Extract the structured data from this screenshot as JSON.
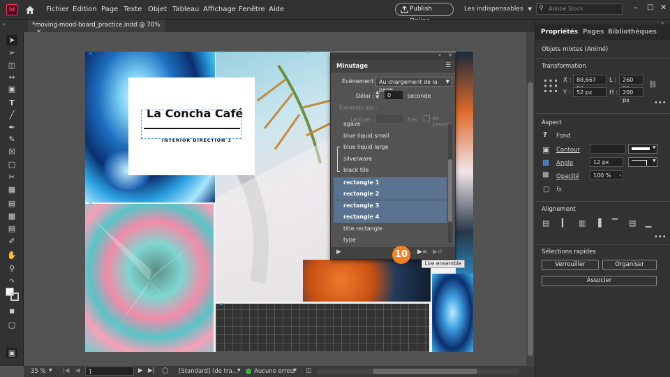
{
  "app": {
    "logo": "Id",
    "menus": [
      "Fichier",
      "Edition",
      "Page",
      "Texte",
      "Objet",
      "Tableau",
      "Affichage",
      "Fenêtre",
      "Aide"
    ],
    "publish_label": "Publish Online",
    "workspace": "Les indispensables",
    "stock_placeholder": "Adobe Stock"
  },
  "document_tab": {
    "title": "*moving-mood-board_practice.indd @ 70%",
    "close": "×"
  },
  "artboard": {
    "cafe_title": "La Concha Café",
    "cafe_subtitle": "INTERIOR DIRECTION 1"
  },
  "timing_panel": {
    "title": "Minutage",
    "event_label": "Événement :",
    "event_value": "Au chargement de la page",
    "delay_label": "Délai :",
    "delay_value": "0",
    "delay_unit": "seconde",
    "linked_label": "Éléments liés :",
    "play_label": "Lecture :",
    "times_label": "fois",
    "loop_label": "En boucle",
    "items": [
      {
        "label": "agave",
        "selected": false,
        "linked": false
      },
      {
        "label": "blue liquid small",
        "selected": false,
        "linked": false
      },
      {
        "label": "blue liquid large",
        "selected": false,
        "linked": true
      },
      {
        "label": "silverware",
        "selected": false,
        "linked": true
      },
      {
        "label": "black tile",
        "selected": false,
        "linked": true
      },
      {
        "label": "rectangle 1",
        "selected": true,
        "linked": false
      },
      {
        "label": "rectangle 2",
        "selected": true,
        "linked": false
      },
      {
        "label": "rectangle 3",
        "selected": true,
        "linked": false
      },
      {
        "label": "rectangle 4",
        "selected": true,
        "linked": false
      },
      {
        "label": "title rectangle",
        "selected": false,
        "linked": false
      },
      {
        "label": "type",
        "selected": false,
        "linked": false
      }
    ],
    "tooltip": "Lire ensemble",
    "step_number": "10"
  },
  "properties": {
    "tabs": [
      "Propriétés",
      "Pages",
      "Bibliothèques"
    ],
    "object_type": "Objets mixtes (Animé)",
    "transform_title": "Transformation",
    "x_label": "X :",
    "x_value": "88,667 px",
    "y_label": "Y :",
    "y_value": "52 px",
    "w_label": "L :",
    "w_value": "260 px",
    "h_label": "H :",
    "h_value": "200 px",
    "aspect_title": "Aspect",
    "fill_label": "Fond",
    "stroke_label": "Contour",
    "angle_label": "Angle",
    "angle_value": "12 px",
    "opacity_label": "Opacité",
    "opacity_value": "100 %",
    "fx_label": "fx.",
    "align_title": "Alignement",
    "quick_title": "Sélections rapides",
    "lock_label": "Verrouiller",
    "arrange_label": "Organiser",
    "group_label": "Associer"
  },
  "status": {
    "zoom": "35 %",
    "page": "1",
    "style": "[Standard] (de tra...",
    "errors": "Aucune erreur"
  },
  "colors": {
    "accent": "#f58220",
    "selection": "#5a7390",
    "logo_bg": "#49021f",
    "logo_fg": "#ff3366"
  }
}
